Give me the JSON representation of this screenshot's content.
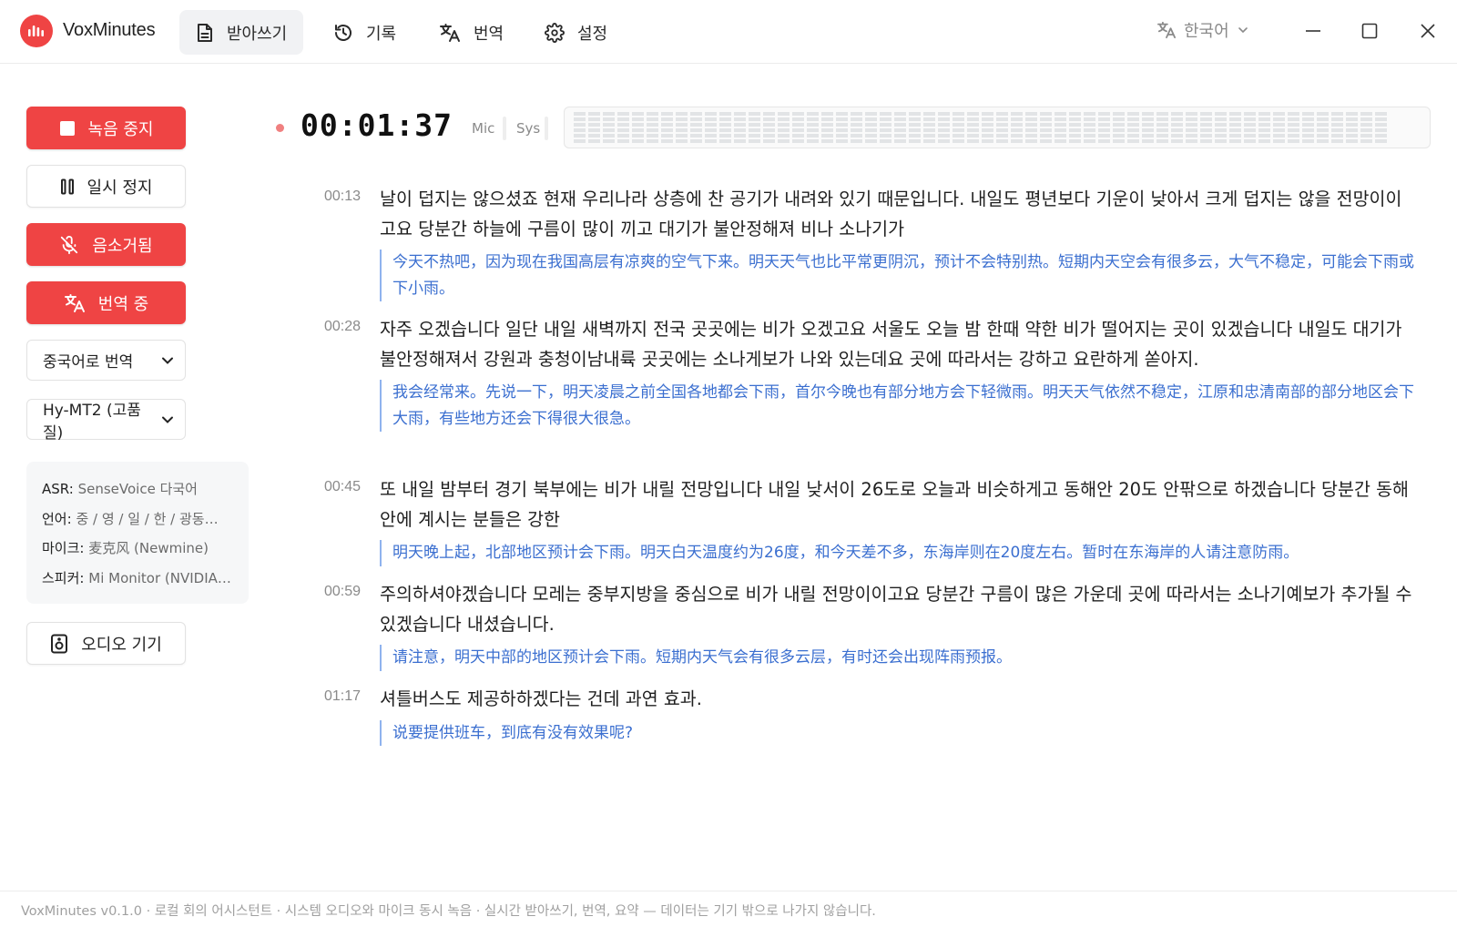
{
  "app": {
    "name": "VoxMinutes"
  },
  "nav": {
    "items": [
      {
        "label": "받아쓰기",
        "icon": "document-icon",
        "active": true
      },
      {
        "label": "기록",
        "icon": "history-icon",
        "active": false
      },
      {
        "label": "번역",
        "icon": "translate-icon",
        "active": false
      },
      {
        "label": "설정",
        "icon": "gear-icon",
        "active": false
      }
    ]
  },
  "language_selector": {
    "value": "한국어",
    "icon": "translate-icon"
  },
  "window_controls": [
    "minimize-icon",
    "maximize-icon",
    "close-icon"
  ],
  "sidebar": {
    "stop_label": "녹음 중지",
    "pause_label": "일시 정지",
    "mute_label": "음소거됨",
    "translating_label": "번역 중",
    "target_language": "중국어로 번역",
    "model": "Hy-MT2 (고품질)",
    "info": {
      "asr_key": "ASR:",
      "asr_val": "SenseVoice 다국어",
      "lang_key": "언어:",
      "lang_val": "중 / 영 / 일 / 한 / 광동…",
      "mic_key": "마이크:",
      "mic_val": "麦克风 (Newmine)",
      "speaker_key": "스피커:",
      "speaker_val": "Mi Monitor (NVIDIA…"
    },
    "audio_devices_label": "오디오 기기"
  },
  "recording": {
    "timer": "00:01:37",
    "mic_label": "Mic",
    "sys_label": "Sys",
    "accent": "#ef4444"
  },
  "transcript": [
    {
      "time": "00:13",
      "ko": "날이 덥지는 않으셨죠 현재 우리나라 상층에 찬 공기가 내려와 있기 때문입니다. 내일도 평년보다 기운이 낮아서 크게 덥지는 않을 전망이이고요 당분간 하늘에 구름이 많이 끼고 대기가 불안정해져 비나 소나기가",
      "zh": "今天不热吧，因为现在我国高层有凉爽的空气下来。明天天气也比平常更阴沉，预计不会特别热。短期内天空会有很多云，大气不稳定，可能会下雨或下小雨。"
    },
    {
      "time": "00:28",
      "ko": "자주 오겠습니다 일단 내일 새벽까지 전국 곳곳에는 비가 오겠고요 서울도 오늘 밤 한때 약한 비가 떨어지는 곳이 있겠습니다 내일도 대기가 불안정해져서 강원과 충청이남내륙 곳곳에는 소나게보가 나와 있는데요 곳에 따라서는 강하고 요란하게 쏟아지.",
      "zh": "我会经常来。先说一下，明天凌晨之前全国各地都会下雨，首尔今晚也有部分地方会下轻微雨。明天天气依然不稳定，江原和忠清南部的部分地区会下大雨，有些地方还会下得很大很急。"
    },
    {
      "time": "00:45",
      "ko": "또 내일 밤부터 경기 북부에는 비가 내릴 전망입니다 내일 낮서이 26도로 오늘과 비슷하게고 동해안 20도 안팎으로 하겠습니다 당분간 동해안에 계시는 분들은 강한",
      "zh": "明天晚上起，北部地区预计会下雨。明天白天温度约为26度，和今天差不多，东海岸则在20度左右。暂时在东海岸的人请注意防雨。"
    },
    {
      "time": "00:59",
      "ko": "주의하셔야겠습니다 모레는 중부지방을 중심으로 비가 내릴 전망이이고요 당분간 구름이 많은 가운데 곳에 따라서는 소나기예보가 추가될 수 있겠습니다 내셨습니다.",
      "zh": "请注意，明天中部的地区预计会下雨。短期内天气会有很多云层，有时还会出现阵雨预报。"
    },
    {
      "time": "01:17",
      "ko": "셔틀버스도 제공하하겠다는 건데 과연 효과.",
      "zh": "说要提供班车，到底有没有效果呢?"
    }
  ],
  "footer": "VoxMinutes v0.1.0 · 로컬 회의 어시스턴트 · 시스템 오디오와 마이크 동시 녹음 · 실시간 받아쓰기, 번역, 요약 — 데이터는 기기 밖으로 나가지 않습니다."
}
